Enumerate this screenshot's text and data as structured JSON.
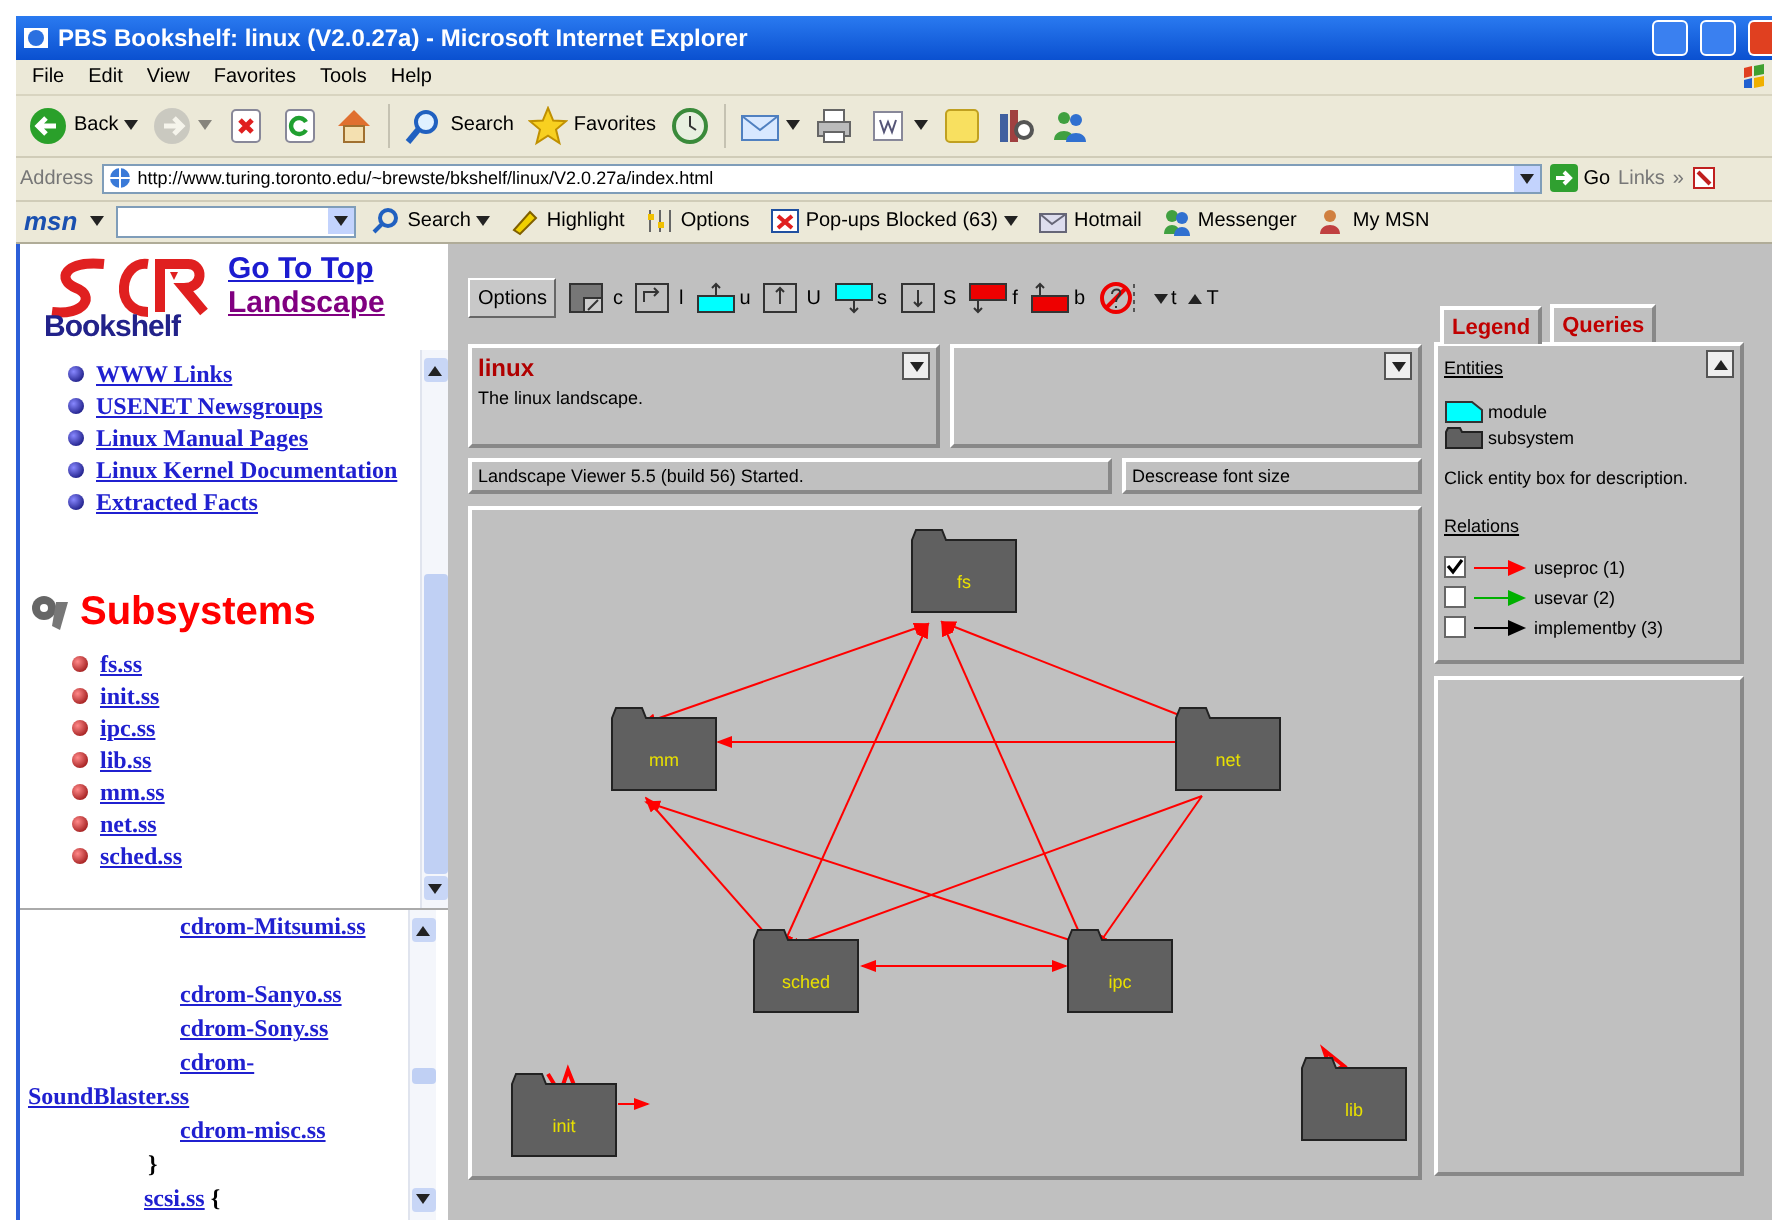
{
  "window": {
    "title": "PBS Bookshelf: linux (V2.0.27a) - Microsoft Internet Explorer"
  },
  "menu": [
    "File",
    "Edit",
    "View",
    "Favorites",
    "Tools",
    "Help"
  ],
  "toolbar": [
    {
      "label": "Back",
      "dropdown": true,
      "disabled": false
    },
    {
      "dropdown": true,
      "disabled": true
    },
    {
      "dropdown": false,
      "disabled": false
    },
    {
      "dropdown": false,
      "disabled": false
    },
    {
      "dropdown": false,
      "disabled": false
    },
    {
      "label": "Search",
      "dropdown": false,
      "disabled": false
    },
    {
      "label": "Favorites",
      "dropdown": false,
      "disabled": false
    },
    {
      "dropdown": false,
      "disabled": false
    },
    {
      "dropdown": true,
      "disabled": false
    },
    {
      "dropdown": false,
      "disabled": false
    },
    {
      "dropdown": true,
      "disabled": false
    },
    {
      "dropdown": false,
      "disabled": false
    },
    {
      "dropdown": false,
      "disabled": false
    },
    {
      "dropdown": false,
      "disabled": false
    }
  ],
  "address": {
    "label": "Address",
    "value": "http://www.turing.toronto.edu/~brewste/bkshelf/linux/V2.0.27a/index.html",
    "go": "Go",
    "links": "Links",
    "more": "»"
  },
  "msn": {
    "logo": "msn",
    "items": [
      {
        "label": "Search",
        "dropdown": true
      },
      {
        "label": "Highlight",
        "dropdown": false
      },
      {
        "label": "Options",
        "dropdown": false
      },
      {
        "label": "Pop-ups Blocked (63)",
        "dropdown": true
      },
      {
        "label": "Hotmail",
        "dropdown": false
      },
      {
        "label": "Messenger",
        "dropdown": false
      },
      {
        "label": "My MSN",
        "dropdown": false
      }
    ]
  },
  "sidebar": {
    "logo": "Bookshelf",
    "header_links": [
      {
        "label": "Go To Top",
        "visited": false
      },
      {
        "label": "Landscape",
        "visited": true
      }
    ],
    "links": [
      "WWW Links",
      "USENET Newsgroups",
      "Linux Manual Pages",
      "Linux Kernel Documentation",
      "Extracted Facts"
    ],
    "section_title": "Subsystems",
    "subsystems": [
      "fs.ss",
      "init.ss",
      "ipc.ss",
      "lib.ss",
      "mm.ss",
      "net.ss",
      "sched.ss"
    ],
    "lower_lines": [
      {
        "kind": "file",
        "text": "cdrom-Mitsumi.ss"
      },
      {
        "kind": "file",
        "text": "cdrom-Sanyo.ss"
      },
      {
        "kind": "file",
        "text": "cdrom-Sony.ss"
      },
      {
        "kind": "file",
        "text": "cdrom-SoundBlaster.ss"
      },
      {
        "kind": "file",
        "text": "cdrom-misc.ss"
      },
      {
        "kind": "brace",
        "text": "}"
      },
      {
        "kind": "group",
        "text": "scsi.ss",
        "brace": "{"
      }
    ]
  },
  "viewer": {
    "options": "Options",
    "tools": [
      "c",
      "l",
      "u",
      "U",
      "s",
      "S",
      "f",
      "b"
    ],
    "font_buttons": [
      "t",
      "T"
    ],
    "info": {
      "title": "linux",
      "text": "The linux landscape."
    },
    "status": "Landscape Viewer 5.5 (build 56) Started.",
    "hint": "Descrease font size",
    "nodes": [
      {
        "label": "fs"
      },
      {
        "label": "mm"
      },
      {
        "label": "net"
      },
      {
        "label": "sched"
      },
      {
        "label": "ipc"
      },
      {
        "label": "init"
      },
      {
        "label": "lib"
      }
    ],
    "tabs": [
      {
        "label": "Legend",
        "selected": true
      },
      {
        "label": "Queries",
        "selected": false
      }
    ],
    "legend": {
      "entities_title": "Entities",
      "entities": [
        {
          "label": "module",
          "kind": "module"
        },
        {
          "label": "subsystem",
          "kind": "subsystem"
        }
      ],
      "hint": "Click entity box for description.",
      "relations_title": "Relations",
      "relations": [
        {
          "label": "useproc (1)",
          "checked": true,
          "color": "#ff0000"
        },
        {
          "label": "usevar (2)",
          "checked": false,
          "color": "#00b000"
        },
        {
          "label": "implementby (3)",
          "checked": false,
          "color": "#000000"
        }
      ]
    }
  }
}
